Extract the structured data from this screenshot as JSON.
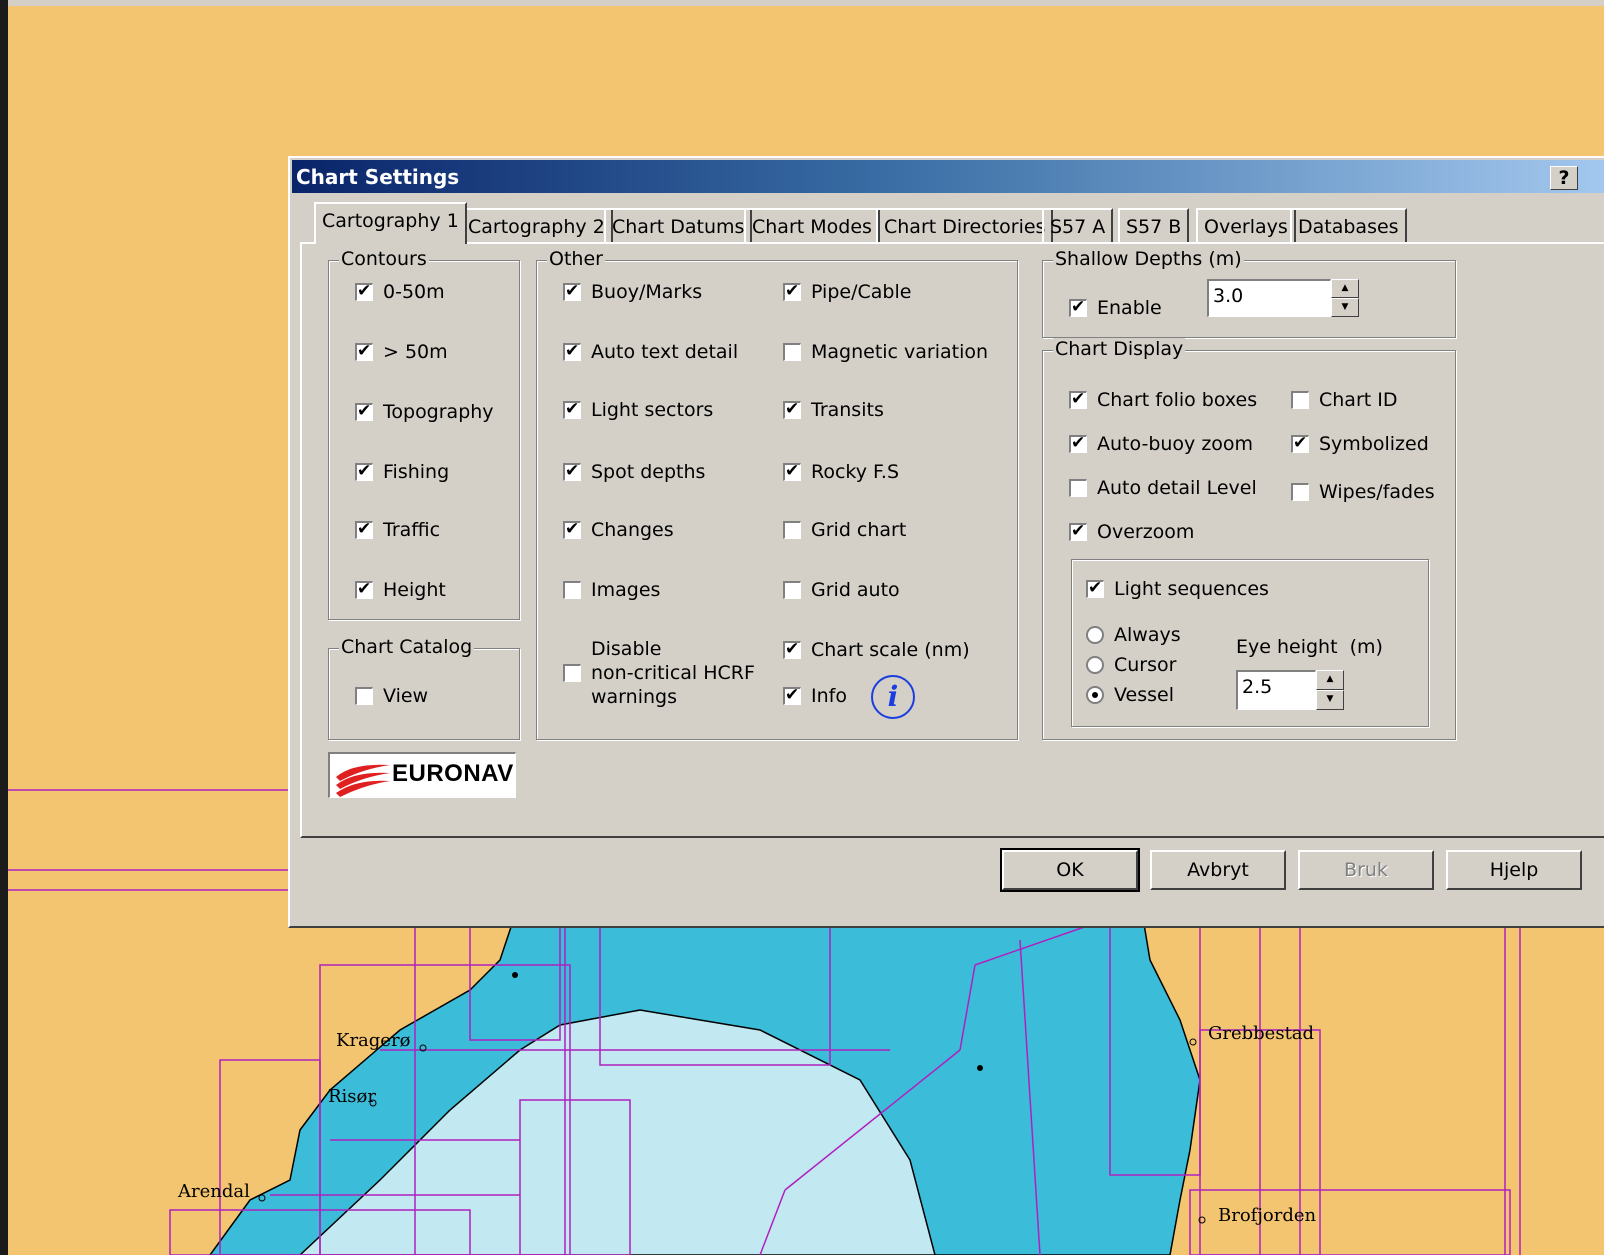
{
  "map": {
    "labels": {
      "kragero": "Kragerø",
      "risor": "Risør",
      "arendal": "Arendal",
      "grebbestad": "Grebbestad",
      "brofjorden": "Brofjorden"
    },
    "colors": {
      "land": "#f3c570",
      "shallow": "#3bbcd9",
      "deep": "#c2e8f2",
      "grid": "#b020c0"
    }
  },
  "dialog": {
    "title": "Chart Settings",
    "help_button": "?",
    "tabs": [
      "Cartography 1",
      "Cartography 2",
      "Chart Datums",
      "Chart Modes",
      "Chart Directories",
      "S57 A",
      "S57 B",
      "Overlays",
      "Databases"
    ],
    "contours": {
      "label": "Contours",
      "items": [
        {
          "label": "0-50m",
          "checked": true
        },
        {
          "label": "> 50m",
          "checked": true
        },
        {
          "label": "Topography",
          "checked": true
        },
        {
          "label": "Fishing",
          "checked": true
        },
        {
          "label": "Traffic",
          "checked": true
        },
        {
          "label": "Height",
          "checked": true
        }
      ]
    },
    "chart_catalog": {
      "label": "Chart Catalog",
      "view": {
        "label": "View",
        "checked": false
      }
    },
    "other": {
      "label": "Other",
      "left": [
        {
          "label": "Buoy/Marks",
          "checked": true
        },
        {
          "label": "Auto text detail",
          "checked": true
        },
        {
          "label": "Light sectors",
          "checked": true
        },
        {
          "label": "Spot depths",
          "checked": true
        },
        {
          "label": "Changes",
          "checked": true
        },
        {
          "label": "Images",
          "checked": false
        }
      ],
      "disable_warnings": {
        "line1": "Disable",
        "line2": "non-critical HCRF",
        "line3": "warnings",
        "checked": false
      },
      "right": [
        {
          "label": "Pipe/Cable",
          "checked": true
        },
        {
          "label": "Magnetic variation",
          "checked": false
        },
        {
          "label": "Transits",
          "checked": true
        },
        {
          "label": "Rocky F.S",
          "checked": true
        },
        {
          "label": "Grid chart",
          "checked": false
        },
        {
          "label": "Grid auto",
          "checked": false
        },
        {
          "label": "Chart scale (nm)",
          "checked": true
        },
        {
          "label": "Info",
          "checked": true
        }
      ],
      "info_icon": "i"
    },
    "shallow_depths": {
      "label": "Shallow Depths (m)",
      "enable": {
        "label": "Enable",
        "checked": true
      },
      "value": "3.0"
    },
    "chart_display": {
      "label": "Chart Display",
      "items": [
        {
          "label": "Chart folio boxes",
          "checked": true
        },
        {
          "label": "Chart ID",
          "checked": false
        },
        {
          "label": "Auto-buoy  zoom",
          "checked": true
        },
        {
          "label": "Symbolized",
          "checked": true
        },
        {
          "label": "Auto detail Level",
          "checked": false
        },
        {
          "label": "Wipes/fades",
          "checked": false
        },
        {
          "label": "Overzoom",
          "checked": true
        }
      ],
      "light_sequences": {
        "label": "Light sequences",
        "checked": true,
        "options": [
          {
            "label": "Always",
            "selected": false
          },
          {
            "label": "Cursor",
            "selected": false
          },
          {
            "label": "Vessel",
            "selected": true
          }
        ],
        "eye_height_label": "Eye height  (m)",
        "eye_height_value": "2.5"
      }
    },
    "logo_text": "EURONAV",
    "buttons": {
      "ok": "OK",
      "cancel": "Avbryt",
      "apply": "Bruk",
      "help": "Hjelp"
    }
  }
}
